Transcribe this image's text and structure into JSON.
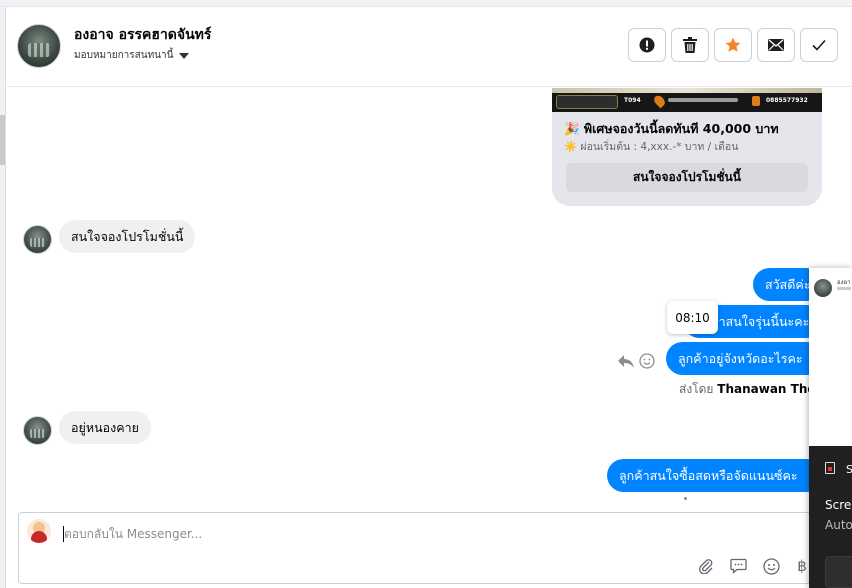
{
  "header": {
    "contact_name": "องอาจ อรรคฮาดจันทร์",
    "assign_label": "มอบหมายการสนทนานี้",
    "actions": [
      {
        "name": "spam",
        "icon": "alert-circle-icon"
      },
      {
        "name": "delete",
        "icon": "trash-icon"
      },
      {
        "name": "star",
        "icon": "star-icon",
        "color": "#f5852a"
      },
      {
        "name": "mark-unread",
        "icon": "envelope-icon"
      },
      {
        "name": "done",
        "icon": "check-icon"
      }
    ]
  },
  "promo_card": {
    "title": "🎉 พิเศษจองวันนี้ลดทันที 40,000 บาท",
    "subtitle": "☀️ ผ่อนเริ่มต้น : 4,xxx.-* บาท / เดือน",
    "button_label": "สนใจจองโปรโมชั่นนี้",
    "banner_texts": [
      "T094",
      "0885577932"
    ]
  },
  "messages": [
    {
      "direction": "in",
      "text": "สนใจจองโปรโมชั่นนี้"
    },
    {
      "direction": "out",
      "text": "สวัสดีค่ะ"
    },
    {
      "direction": "out",
      "text": "ลูกค้าสนใจรุ่นนี้นะคะ"
    },
    {
      "direction": "out",
      "text": "ลูกค้าอยู่จังหวัดอะไรคะ"
    },
    {
      "direction": "in",
      "text": "อยู่หนองคาย"
    },
    {
      "direction": "out",
      "text": "ลูกค้าสนใจซื้อสดหรือจัดแนนซ์คะ"
    }
  ],
  "tooltip_time": "08:10",
  "sent_by": {
    "prefix": "ส่งโดย",
    "name": "Thanawan Thon"
  },
  "composer": {
    "placeholder": "ตอบกลับใน Messenger...",
    "tools": [
      "paperclip-icon",
      "chat-bubble-icon",
      "emoji-icon",
      "baht-icon"
    ],
    "baht_symbol": "฿"
  },
  "popup": {
    "title": "องอา",
    "notif_letter": "S",
    "line1": "Scre",
    "line2": "Auto"
  },
  "colors": {
    "outgoing_bubble": "#0084ff",
    "incoming_bubble": "#f0f0f0",
    "card_bg": "#e4e6eb",
    "star": "#f5852a"
  }
}
